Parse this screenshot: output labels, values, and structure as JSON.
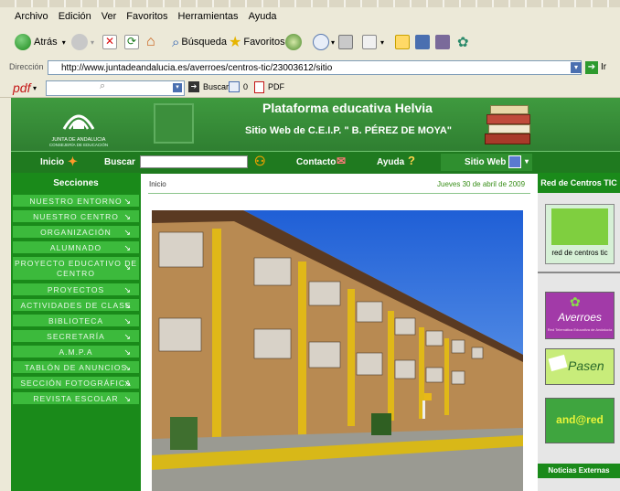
{
  "menu": [
    "Archivo",
    "Edición",
    "Ver",
    "Favoritos",
    "Herramientas",
    "Ayuda"
  ],
  "toolbar": {
    "back_label": "Atrás",
    "search_label": "Búsqueda",
    "favorites_label": "Favoritos"
  },
  "address": {
    "label": "Dirección",
    "url": "http://www.juntadeandalucia.es/averroes/centros-tic/23003612/sitio",
    "go_label": "Ir"
  },
  "pdfbar": {
    "logo": "pdf",
    "search_label": "Buscar",
    "count": "0",
    "pdf_label": "PDF"
  },
  "site": {
    "platform_title": "Plataforma educativa Helvia",
    "subtitle": "Sitio Web de C.E.I.P. \" B. PÉREZ DE MOYA\"",
    "logo_text": "JUNTA DE ANDALUCIA",
    "logo_subtext": "CONSEJERÍA DE EDUCACIÓN"
  },
  "nav": {
    "home": "Inicio",
    "search": "Buscar",
    "contact": "Contacto",
    "help": "Ayuda",
    "site": "Sitio Web"
  },
  "sections": {
    "title": "Secciones",
    "items": [
      "NUESTRO ENTORNO",
      "NUESTRO CENTRO",
      "ORGANIZACIÓN",
      "ALUMNADO",
      "PROYECTO EDUCATIVO DE CENTRO",
      "PROYECTOS",
      "ACTIVIDADES DE CLASE",
      "BIBLIOTECA",
      "SECRETARÍA",
      "A.M.P.A",
      "TABLÓN DE ANUNCIOS",
      "SECCIÓN FOTOGRÁFICA",
      "REVISTA ESCOLAR"
    ]
  },
  "content": {
    "breadcrumb": "Inicio",
    "date": "Jueves 30 de abril de 2009"
  },
  "right": {
    "title": "Red de Centros TIC",
    "tic_caption": "red de centros tic",
    "averroes": "Averroes",
    "averroes_sub": "Red Telemática Educativa de Andalucía",
    "pasen": "Pasen",
    "andared": "and@red",
    "news": "Noticias Externas"
  },
  "colors": {
    "site_green": "#2f8a2f",
    "section_green": "#3cba3c",
    "date_green": "#3a8f1a"
  }
}
